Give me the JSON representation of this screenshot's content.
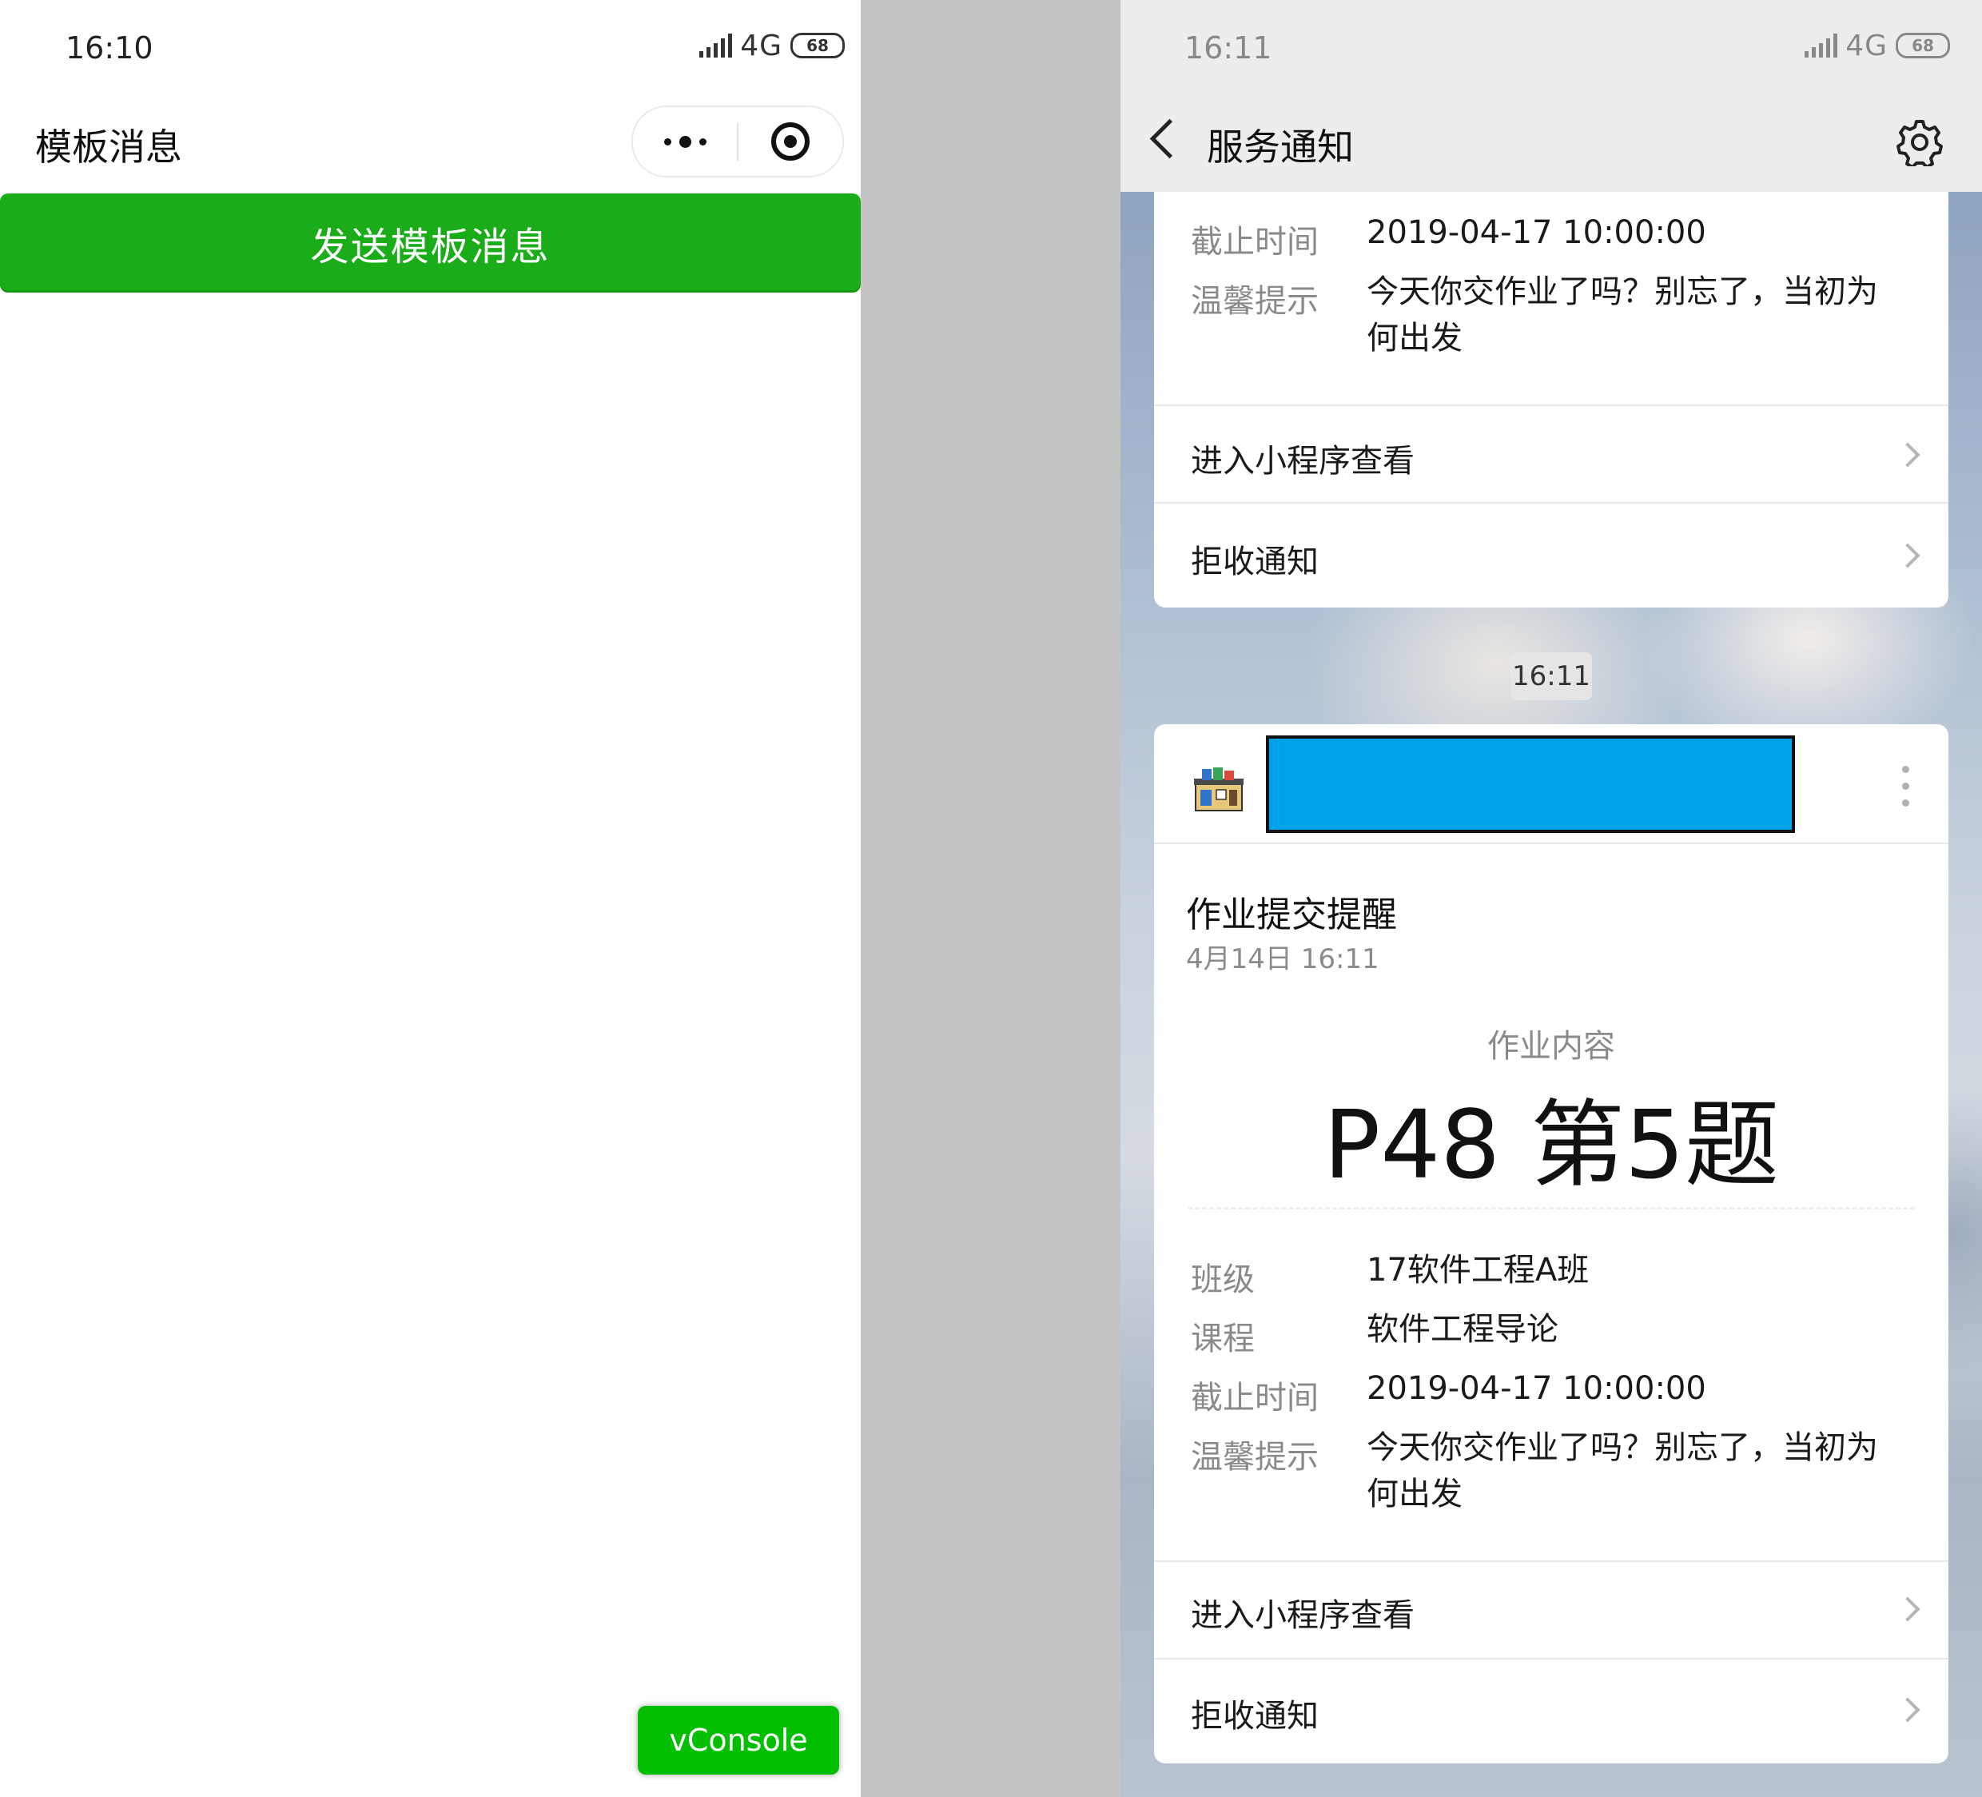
{
  "left": {
    "status_time": "16:10",
    "network": "4G",
    "battery": "68",
    "title": "模板消息",
    "send_button": "发送模板消息",
    "vconsole": "vConsole"
  },
  "right": {
    "status_time": "16:11",
    "network": "4G",
    "battery": "68",
    "title": "服务通知",
    "top_card": {
      "rows": [
        {
          "label": "截止时间",
          "value": "2019-04-17 10:00:00"
        },
        {
          "label": "温馨提示",
          "value": "今天你交作业了吗？别忘了，当初为何出发"
        }
      ],
      "link_view": "进入小程序查看",
      "link_reject": "拒收通知"
    },
    "time_pill": "16:11",
    "message": {
      "title": "作业提交提醒",
      "date": "4月14日  16:11",
      "key_label": "作业内容",
      "key_value": "P48 第5题",
      "rows": [
        {
          "label": "班级",
          "value": "17软件工程A班"
        },
        {
          "label": "课程",
          "value": "软件工程导论"
        },
        {
          "label": "截止时间",
          "value": "2019-04-17 10:00:00"
        },
        {
          "label": "温馨提示",
          "value": "今天你交作业了吗？别忘了，当初为何出发"
        }
      ],
      "link_view": "进入小程序查看",
      "link_reject": "拒收通知"
    }
  },
  "colors": {
    "wechat_green": "#1aad19",
    "vconsole_green": "#04be02",
    "redaction_blue": "#00a2e8"
  }
}
